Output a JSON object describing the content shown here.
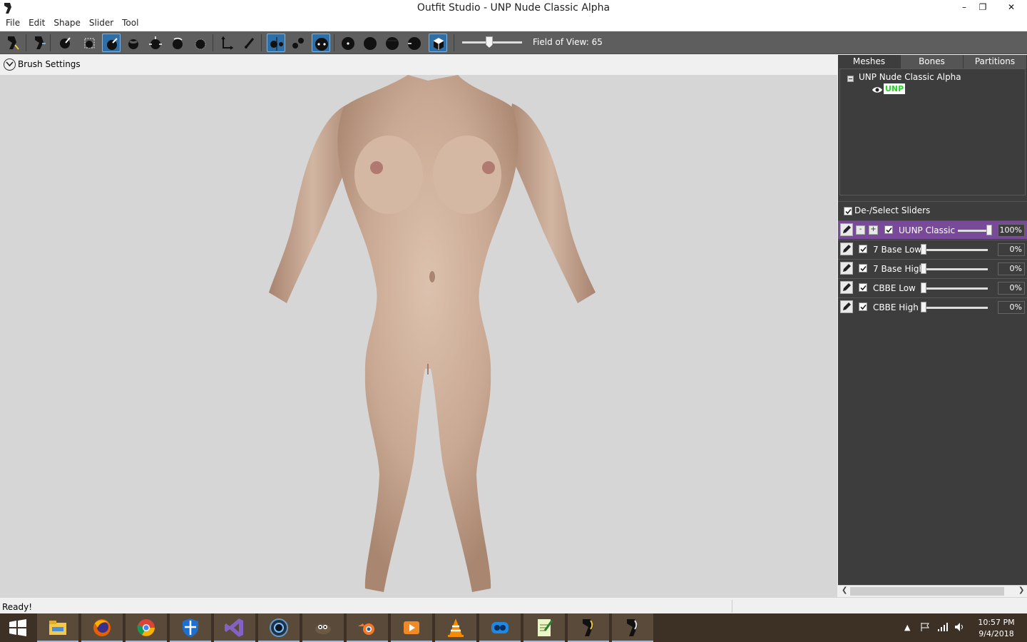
{
  "window": {
    "title": "Outfit Studio - UNP Nude Classic Alpha",
    "minimize_label": "–",
    "restore_label": "❐",
    "close_label": "✕"
  },
  "menu": [
    "File",
    "Edit",
    "Shape",
    "Slider",
    "Tool"
  ],
  "toolbar": {
    "fov_label": "Field of View: 65",
    "fov_level": 0.45,
    "tools": [
      {
        "icon": "new-project-icon",
        "active": false
      },
      {
        "icon": "load-project-icon",
        "active": false
      },
      {
        "icon": "select-brush-icon",
        "active": false
      },
      {
        "icon": "mask-brush-icon",
        "active": false
      },
      {
        "icon": "inflate-brush-icon",
        "active": true
      },
      {
        "icon": "deflate-brush-icon",
        "active": false
      },
      {
        "icon": "move-brush-icon",
        "active": false
      },
      {
        "icon": "smooth-brush-icon",
        "active": false
      },
      {
        "icon": "weight-brush-icon",
        "active": false
      },
      {
        "icon": "transform-icon",
        "active": false
      },
      {
        "icon": "pivot-icon",
        "active": false
      },
      {
        "icon": "x-mirror-icon",
        "active": true
      },
      {
        "icon": "connected-only-icon",
        "active": false
      },
      {
        "icon": "global-brush-icon",
        "active": true
      },
      {
        "icon": "shade-icon-1",
        "active": false
      },
      {
        "icon": "shade-icon-2",
        "active": false
      },
      {
        "icon": "shade-icon-3",
        "active": false
      },
      {
        "icon": "shade-icon-4",
        "active": false
      },
      {
        "icon": "texture-toggle-icon",
        "active": true
      }
    ]
  },
  "brush_settings": {
    "label": "Brush Settings"
  },
  "right_panel": {
    "tabs": [
      "Meshes",
      "Bones",
      "Partitions"
    ],
    "active_tab": "Meshes",
    "tree_root": "UNP Nude Classic Alpha",
    "mesh_node": "UNP",
    "slider_header": "De-/Select Sliders",
    "sliders": [
      {
        "name": "UUNP Classic",
        "value": "100%",
        "level": 1.0,
        "active": true
      },
      {
        "name": "7 Base Low",
        "value": "0%",
        "level": 0.0,
        "active": false
      },
      {
        "name": "7 Base High",
        "value": "0%",
        "level": 0.0,
        "active": false
      },
      {
        "name": "CBBE Low",
        "value": "0%",
        "level": 0.0,
        "active": false
      },
      {
        "name": "CBBE High",
        "value": "0%",
        "level": 0.0,
        "active": false
      }
    ]
  },
  "status": {
    "text": "Ready!"
  },
  "taskbar": {
    "apps": [
      "windows-start-icon",
      "file-explorer-icon",
      "firefox-icon",
      "chrome-icon",
      "defender-icon",
      "visual-studio-icon",
      "camera-app-icon",
      "gimp-icon",
      "blender-icon",
      "media-player-icon",
      "vlc-icon",
      "messenger-icon",
      "notepad-icon",
      "outfit-studio-icon",
      "bodyslide-icon"
    ],
    "time": "10:57 PM",
    "date": "9/4/2018"
  },
  "colors": {
    "toolbar_bg": "#5e5e5e",
    "panel_bg": "#3d3d3d",
    "active_slider": "#7a4a9a",
    "viewport_bg": "#d6d6d6",
    "mesh_node_text": "#2bd12b",
    "taskbar_bg": "#3d3126"
  }
}
